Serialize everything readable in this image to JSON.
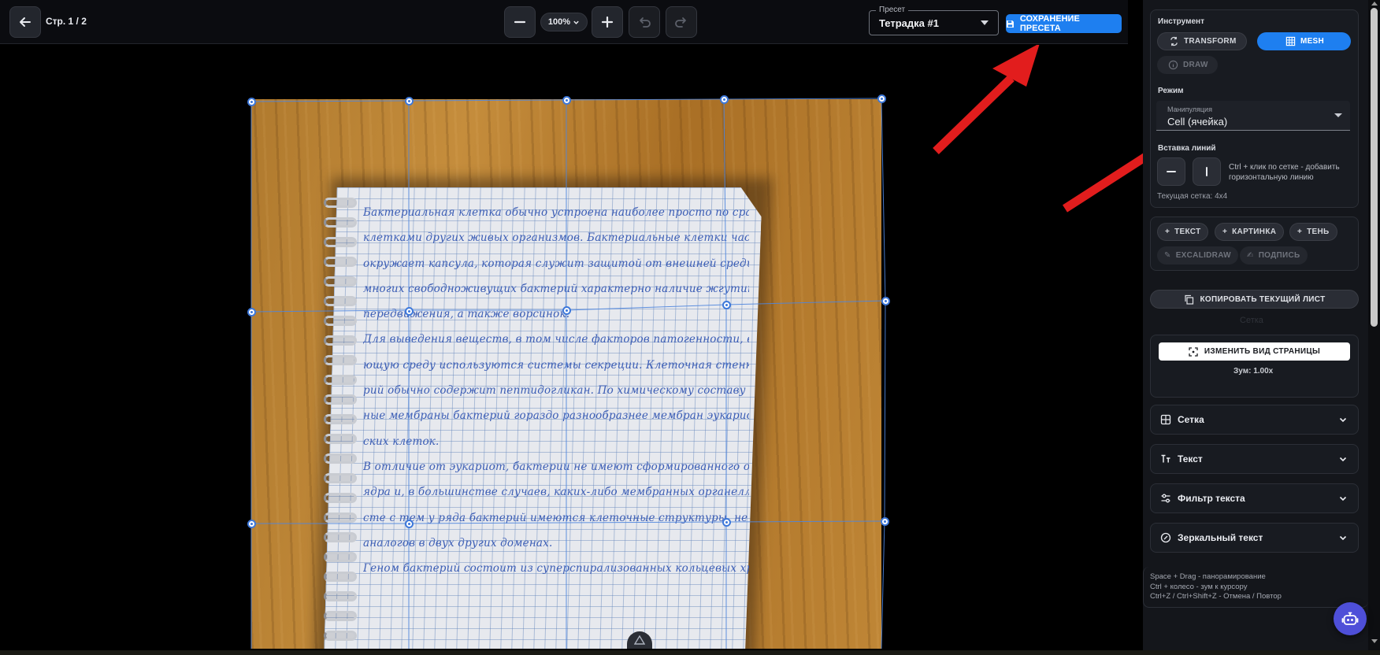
{
  "topbar": {
    "page_label": "Стр. 1 / 2",
    "zoom_value": "100%",
    "preset_label": "Пресет",
    "preset_value": "Тетрадка #1",
    "save_preset_label": "СОХРАНЕНИЕ ПРЕСЕТА"
  },
  "notebook_text": [
    "Бактериальная клетка обычно устроена наиболее просто по сравнению с",
    "клетками других живых организмов. Бактериальные клетки часто",
    "окружает капсула, которая служит защитой от внешней среды. Для",
    "многих свободноживущих бактерий характерно наличие жгутиков для",
    "передвижения, а также ворсинок.",
    "Для выведения веществ, в том числе факторов патогенности, в окружа-",
    "ющую среду используются системы секреции. Клеточная стенка бакте-",
    "рий обычно содержит пептидогликан. По химическому составу клеточ-",
    "ные мембраны бактерий гораздо разнообразнее мембран эукариотиче-",
    "ских клеток.",
    "В отличие от эукариот, бактерии не имеют сформированного оформленно-",
    "ядра и, в большинстве случаев, каких-либо мембранных органелл. Вме-",
    "сте с тем у ряда бактерий имеются клеточные структуры, не имеющие",
    "аналогов в двух других доменах.",
    "Геном бактерий состоит из суперспирализованных кольцевых хромосом, свя-"
  ],
  "panel": {
    "tool_label": "Инструмент",
    "tools": {
      "transform": "TRANSFORM",
      "mesh": "MESH",
      "draw": "DRAW"
    },
    "mode_label": "Режим",
    "mode_select_label": "Манипуляция",
    "mode_select_value": "Cell (ячейка)",
    "insert_lines_label": "Вставка линий",
    "insert_hint": "Ctrl + клик по сетке - добавить горизонтальную линию",
    "current_grid": "Текущая сетка: 4x4",
    "add_text": "ТЕКСТ",
    "add_image": "КАРТИНКА",
    "add_shadow": "ТЕНЬ",
    "excalidraw": "EXCALIDRAW",
    "signature": "ПОДПИСЬ",
    "copy_sheet": "КОПИРОВАТЬ ТЕКУЩИЙ ЛИСТ",
    "ghost_grid": "Сетка",
    "change_view": "ИЗМЕНИТЬ ВИД СТРАНИЦЫ",
    "zoom_text": "Зум: 1.00x",
    "accordions": [
      "Сетка",
      "Текст",
      "Фильтр текста",
      "Зеркальный текст"
    ],
    "shortcuts": [
      "Space + Drag - панорамирование",
      "Ctrl + колесо - зум к курсору",
      "Ctrl+Z / Ctrl+Shift+Z - Отмена / Повтор"
    ]
  },
  "colors": {
    "accent": "#1e7ff0",
    "mesh_line": "#4f86de",
    "annotation_arrow": "#e21d1d",
    "panel_bg": "#14161b",
    "fab": "#4e4fd8"
  },
  "icons": [
    "arrow-left-icon",
    "minus-icon",
    "plus-icon",
    "undo-icon",
    "redo-icon",
    "save-icon",
    "transform-icon",
    "grid-icon",
    "info-icon",
    "copy-icon",
    "focus-icon",
    "chevron-down-icon",
    "text-format-icon",
    "filter-icon",
    "mirror-icon",
    "bot-icon"
  ]
}
